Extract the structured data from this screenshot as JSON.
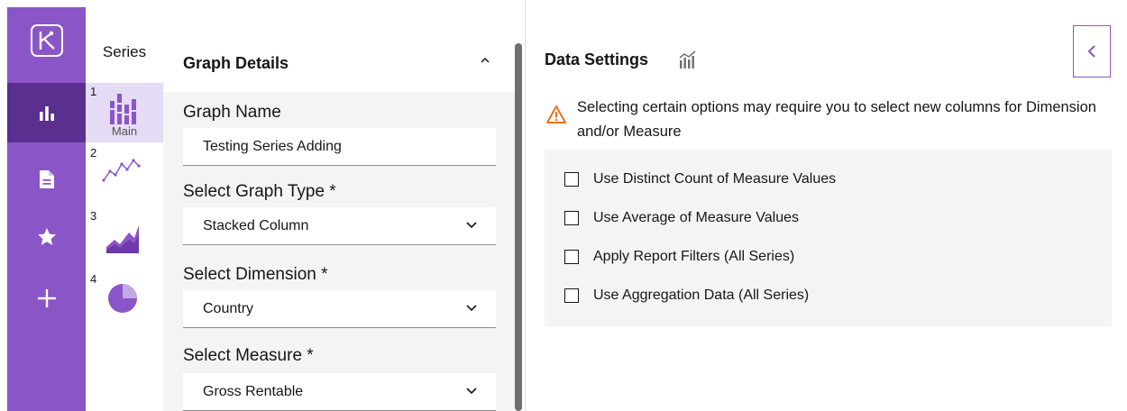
{
  "nav": {
    "items": [
      {
        "name": "logo",
        "icon": "app-logo-icon"
      },
      {
        "name": "charts",
        "icon": "bar-chart-icon",
        "active": true
      },
      {
        "name": "documents",
        "icon": "document-icon"
      },
      {
        "name": "favorites",
        "icon": "star-icon"
      },
      {
        "name": "add",
        "icon": "plus-icon"
      }
    ],
    "accent": "#8a56c7",
    "active_color": "#5a2f8f"
  },
  "series": {
    "title": "Series",
    "items": [
      {
        "num": "1",
        "sub": "Main",
        "icon": "stacked-column-icon"
      },
      {
        "num": "2",
        "sub": "",
        "icon": "line-chart-icon"
      },
      {
        "num": "3",
        "sub": "",
        "icon": "area-chart-icon"
      },
      {
        "num": "4",
        "sub": "",
        "icon": "pie-chart-icon"
      }
    ]
  },
  "details": {
    "title": "Graph Details",
    "graph_name_label": "Graph Name",
    "graph_name_value": "Testing Series Adding",
    "graph_type_label": "Select Graph Type *",
    "graph_type_value": "Stacked Column",
    "dimension_label": "Select Dimension  *",
    "dimension_value": "Country",
    "measure_label": "Select Measure  *",
    "measure_value": "Gross Rentable"
  },
  "data_settings": {
    "title": "Data Settings",
    "warning": "Selecting certain options may require you to select new columns for Dimension and/or Measure",
    "options": [
      "Use Distinct Count of Measure Values",
      "Use Average of Measure Values",
      "Apply Report Filters (All Series)",
      "Use Aggregation Data (All Series)"
    ],
    "warning_color": "#e8711a"
  }
}
